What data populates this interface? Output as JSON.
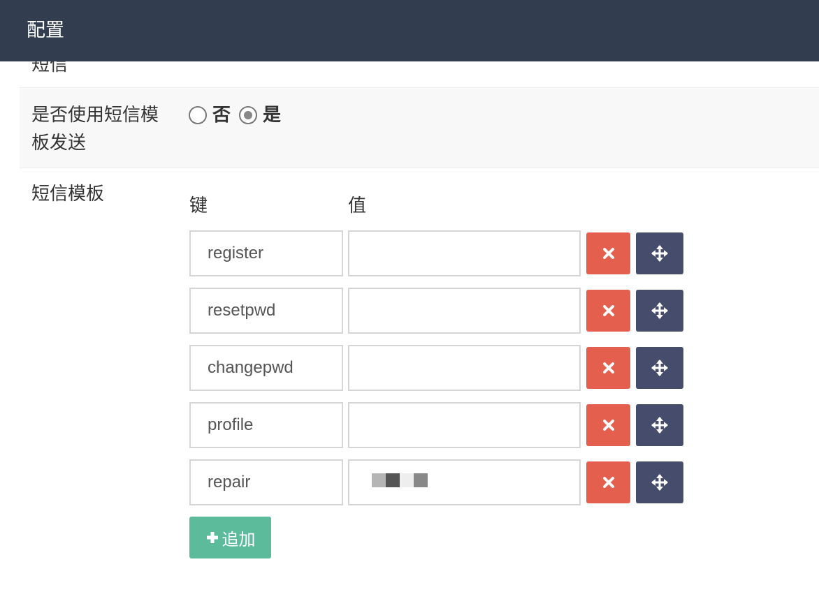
{
  "header": {
    "title": "配置"
  },
  "cut_row": {
    "label": "短信"
  },
  "sms_template_toggle": {
    "label": "是否使用短信模板发送",
    "options": [
      {
        "label": "否",
        "checked": false
      },
      {
        "label": "是",
        "checked": true
      }
    ]
  },
  "sms_templates": {
    "label": "短信模板",
    "key_header": "键",
    "value_header": "值",
    "rows": [
      {
        "key": "register",
        "value": ""
      },
      {
        "key": "resetpwd",
        "value": ""
      },
      {
        "key": "changepwd",
        "value": ""
      },
      {
        "key": "profile",
        "value": ""
      },
      {
        "key": "repair",
        "value": "",
        "value_redacted": true
      }
    ],
    "add_button_label": "追加",
    "colors": {
      "delete": "#e55f4e",
      "move": "#464c6b",
      "add": "#5bbb9b",
      "header_bg": "#323e4f"
    },
    "icons": {
      "delete": "times-icon",
      "move": "arrows-move-icon",
      "add": "plus-icon"
    }
  }
}
